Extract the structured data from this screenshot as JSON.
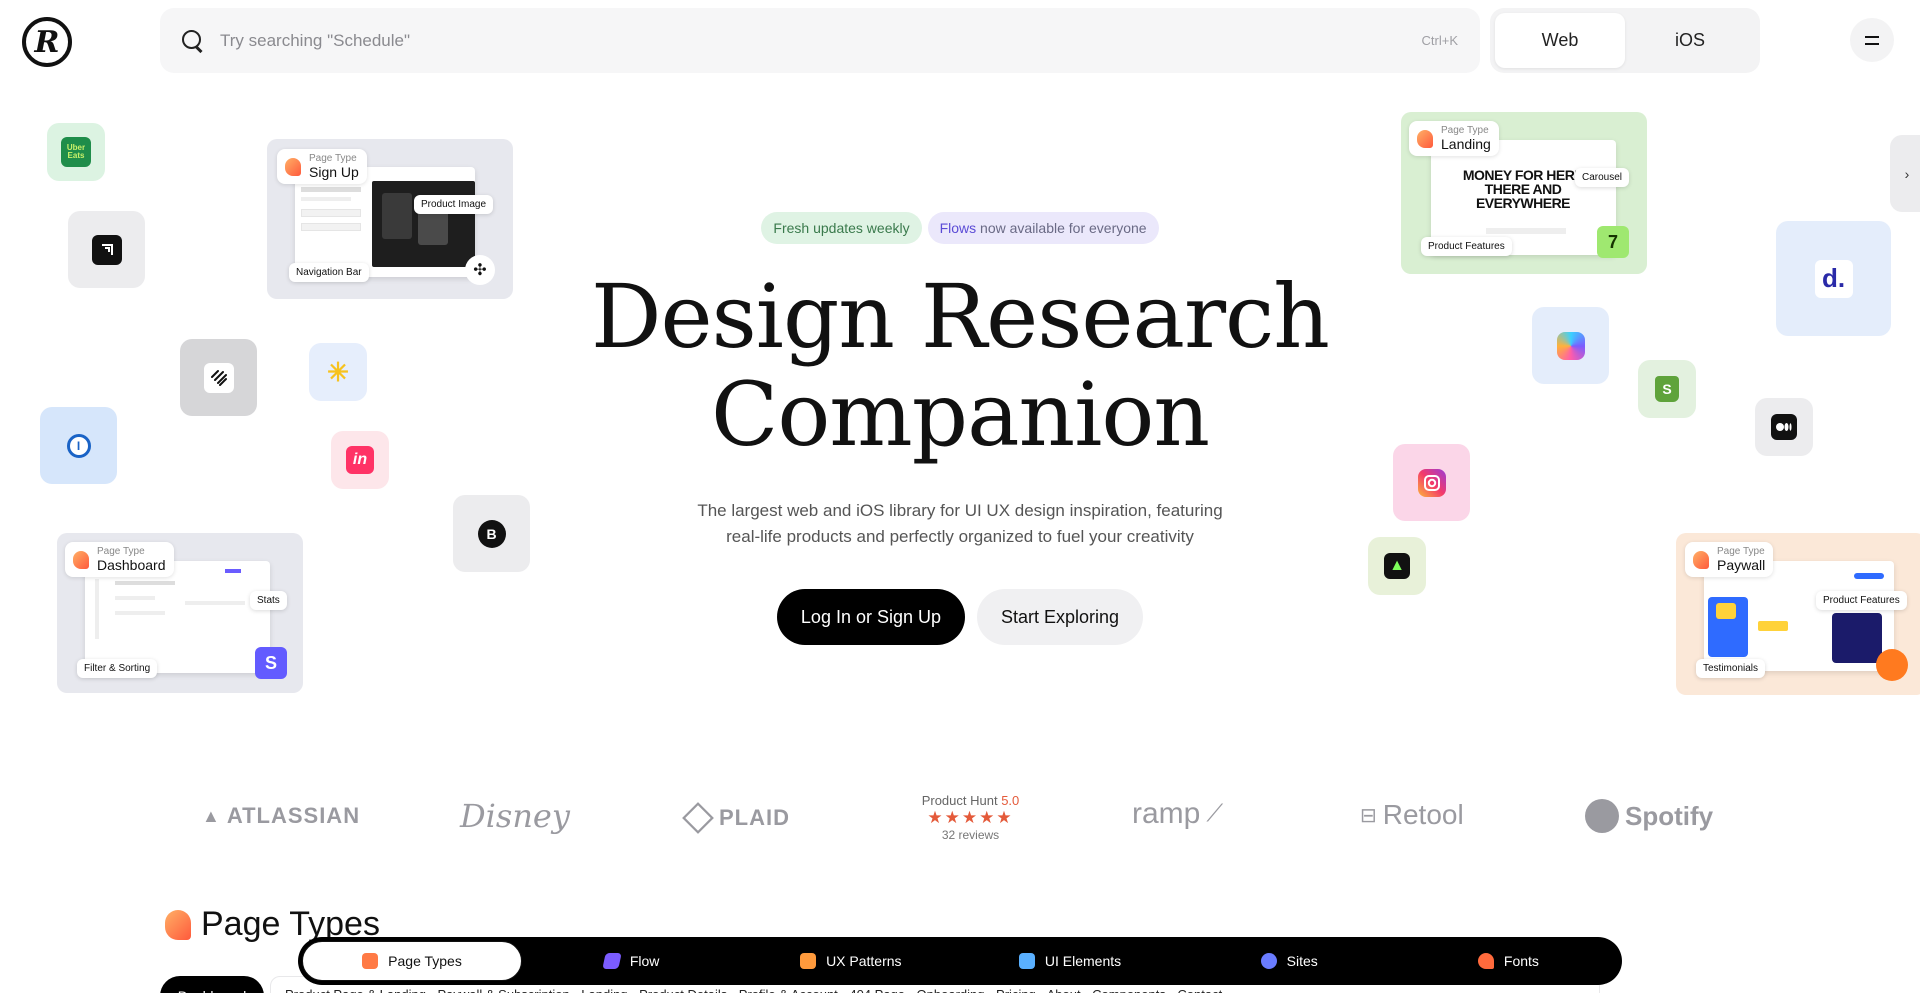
{
  "header": {
    "logo_text": "R",
    "search_placeholder": "Try searching \"Schedule\"",
    "shortcut": "Ctrl+K",
    "platform_tabs": [
      "Web",
      "iOS"
    ]
  },
  "badges": {
    "weekly": "Fresh updates weekly",
    "flows_word": "Flows",
    "flows_rest": " now available for everyone"
  },
  "hero": {
    "title_line1": "Design Research",
    "title_line2": "Companion",
    "subtitle_line1": "The largest web and iOS library for UI UX design inspiration, featuring",
    "subtitle_line2": "real-life products and perfectly organized to fuel your creativity",
    "primary_cta": "Log In or Sign Up",
    "secondary_cta": "Start Exploring"
  },
  "page_type_cards": [
    {
      "small": "Page Type",
      "name": "Sign Up",
      "chips": [
        "Product Image",
        "Navigation Bar"
      ]
    },
    {
      "small": "Page Type",
      "name": "Landing",
      "chips": [
        "Carousel",
        "Product Features"
      ],
      "headline": "MONEY FOR HERE THERE AND EVERYWHERE"
    },
    {
      "small": "Page Type",
      "name": "Dashboard",
      "chips": [
        "Stats",
        "Filter & Sorting"
      ]
    },
    {
      "small": "Page Type",
      "name": "Paywall",
      "chips": [
        "Product Features",
        "Testimonials"
      ]
    }
  ],
  "apps": {
    "ubereats": "Uber Eats",
    "doordash": "d.",
    "invision": "in",
    "zapier": "zapier",
    "bold": "B"
  },
  "logos": {
    "atlassian": "ATLASSIAN",
    "disney": "Disney",
    "plaid": "PLAID",
    "ramp": "ramp",
    "retool": "Retool",
    "spotify": "Spotify",
    "product_hunt_label": "Product Hunt",
    "product_hunt_score": "5.0",
    "product_hunt_stars": "★★★★★",
    "product_hunt_reviews": "32 reviews"
  },
  "section": {
    "title": "Page Types",
    "active_filter": "Dashboard",
    "filters_text": "Product Page & Landing  ·  Paywall & Subscription  ·  Landing  ·  Product Details  ·  Profile & Account  ·  404 Page  ·  Onboarding  ·  Pricing  ·  About  ·  Components  ·  Contact"
  },
  "bottom_nav": [
    {
      "label": "Page Types",
      "color": "#ff7a45"
    },
    {
      "label": "Flow",
      "color": "#7b5cff"
    },
    {
      "label": "UX Patterns",
      "color": "#ff9a3c"
    },
    {
      "label": "UI Elements",
      "color": "#5ab0ff"
    },
    {
      "label": "Sites",
      "color": "#6a7cff"
    },
    {
      "label": "Fonts",
      "color": "#ff6a3c"
    }
  ]
}
